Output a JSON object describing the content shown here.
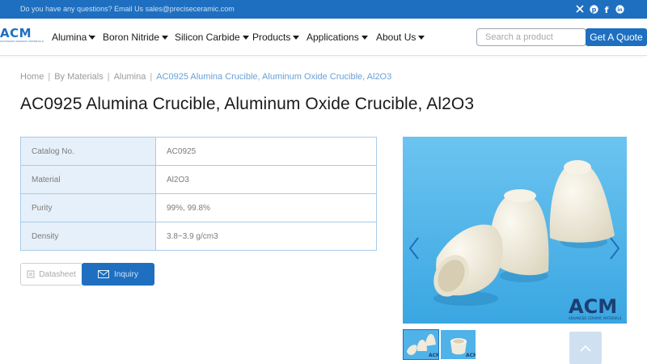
{
  "topbar": {
    "text": "Do you have any questions? Email Us sales@preciseceramic.com",
    "social": [
      "x-icon",
      "pinterest-icon",
      "facebook-icon",
      "linkedin-icon"
    ]
  },
  "header": {
    "logo_text": "ACM",
    "logo_sub": "ADVANCED CERAMIC MATERIALS",
    "nav": [
      "Alumina",
      "Boron Nitride",
      "Silicon Carbide",
      "Products",
      "Applications",
      "About Us"
    ],
    "search_placeholder": "Search a product",
    "quote_label": "Get A Quote"
  },
  "breadcrumb": {
    "items": [
      "Home",
      "By Materials",
      "Alumina"
    ],
    "current": "AC0925 Alumina Crucible, Aluminum Oxide Crucible, Al2O3"
  },
  "page_title": "AC0925 Alumina Crucible, Aluminum Oxide Crucible, Al2O3",
  "specs": [
    {
      "label": "Catalog No.",
      "value": "AC0925"
    },
    {
      "label": "Material",
      "value": "Al2O3"
    },
    {
      "label": "Purity",
      "value": "99%, 99.8%"
    },
    {
      "label": "Density",
      "value": "3.8~3.9 g/cm3"
    }
  ],
  "buttons": {
    "datasheet": "Datasheet",
    "inquiry": "Inquiry"
  },
  "image": {
    "watermark": "ACM",
    "watermark_sub": "ADVANCED CERAMIC MATERIALS",
    "background": "#5ab8ec",
    "ceramic": "#efeadb"
  },
  "thumbnails": [
    "thumb-three-crucibles",
    "thumb-single-crucible"
  ],
  "colors": {
    "brand": "#1e6fc0",
    "table_border": "#a9cbe9",
    "table_key_bg": "#e6f0fa"
  }
}
